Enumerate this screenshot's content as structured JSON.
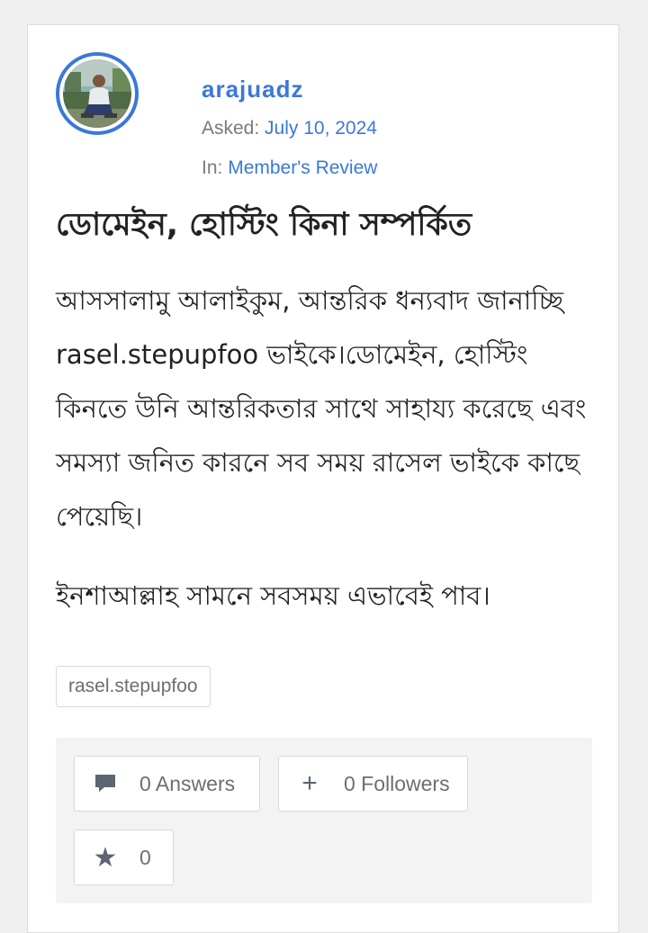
{
  "author": {
    "username": "arajuadz",
    "asked_label": "Asked:",
    "asked_date": "July 10, 2024",
    "in_label": "In:",
    "category": "Member's Review"
  },
  "question": {
    "title": "ডোমেইন, হোস্টিং কিনা সম্পর্কিত",
    "body_paragraph_1": "আসসালামু আলাইকুম, আন্তরিক ধন্যবাদ জানাচ্ছি rasel.stepupfoo ভাইকে।ডোমেইন, হোস্টিং কিনতে উনি আন্তরিকতার সাথে সাহায্য করেছে এবং সমস্যা জনিত কারনে সব সময় রাসেল ভাইকে কাছে পেয়েছি।",
    "body_paragraph_2": "ইনশাআল্লাহ সামনে সবসময় এভাবেই পাব।",
    "tags": [
      "rasel.stepupfoo"
    ]
  },
  "actions": {
    "answers_label": "0 Answers",
    "followers_label": "0 Followers",
    "favorites_count": "0",
    "followers_icon": "+",
    "star_icon": "★"
  },
  "colors": {
    "accent": "#3a78d8",
    "text": "#222222",
    "muted": "#7a7a7a"
  }
}
